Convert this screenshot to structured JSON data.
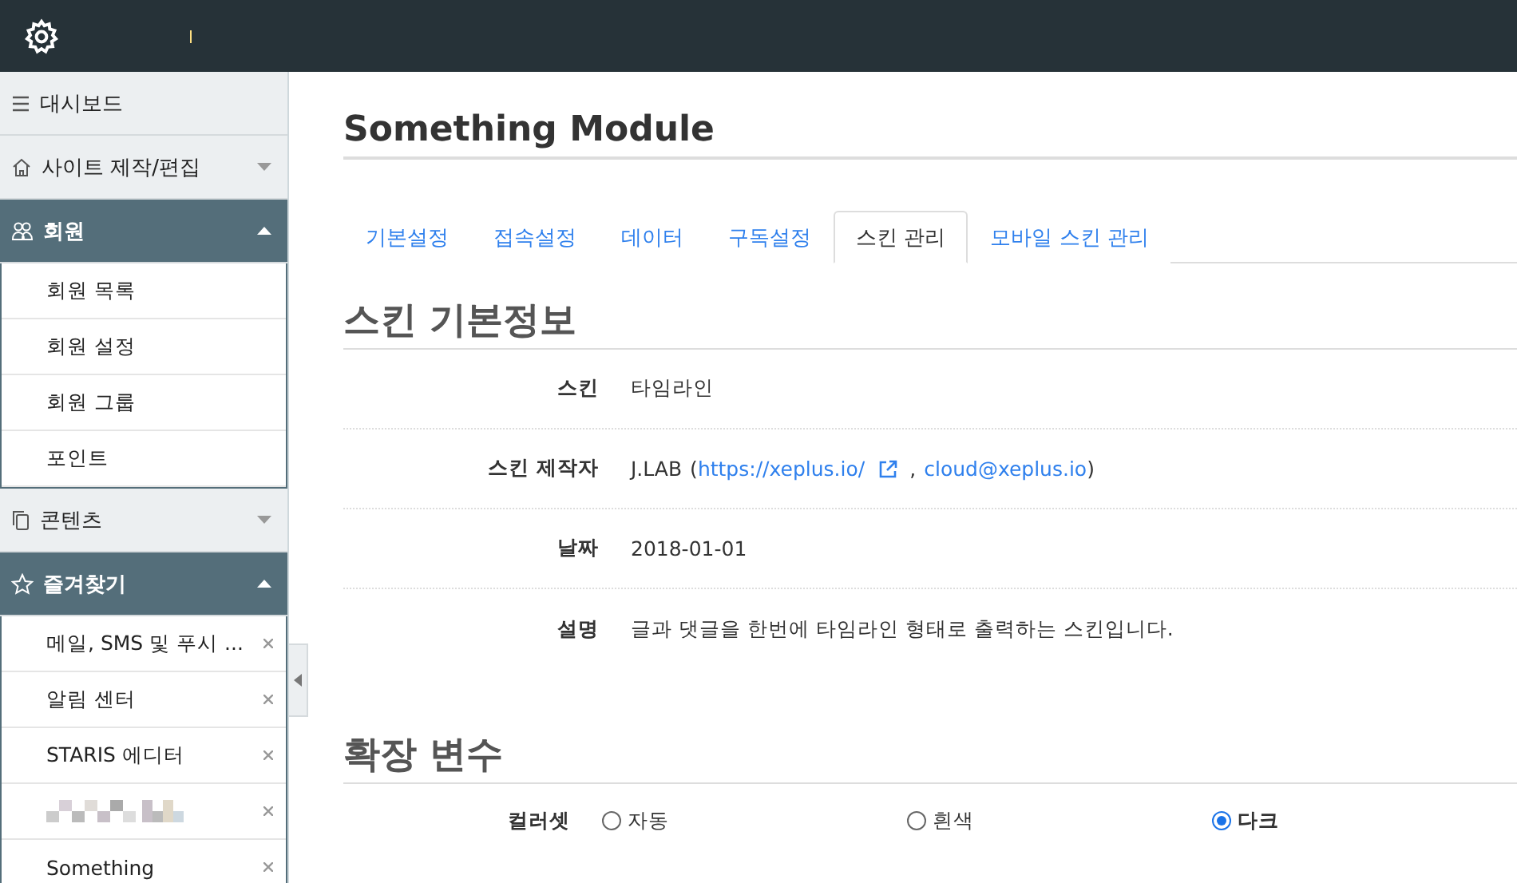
{
  "sidebar": {
    "groups": [
      {
        "label": "대시보드"
      },
      {
        "label": "사이트 제작/편집",
        "expanded": false
      },
      {
        "label": "회원",
        "expanded": true,
        "children": [
          {
            "label": "회원 목록"
          },
          {
            "label": "회원 설정"
          },
          {
            "label": "회원 그룹"
          },
          {
            "label": "포인트"
          }
        ]
      },
      {
        "label": "콘텐츠",
        "expanded": false
      },
      {
        "label": "즐겨찾기",
        "expanded": true,
        "children": [
          {
            "label": "메일, SMS 및 푸시 ...",
            "removable": true
          },
          {
            "label": "알림 센터",
            "removable": true
          },
          {
            "label": "STARIS 에디터",
            "removable": true
          },
          {
            "kind": "blurred",
            "removable": true
          },
          {
            "label": "Something",
            "removable": true
          }
        ]
      }
    ]
  },
  "page": {
    "title": "Something Module",
    "tabs": [
      {
        "label": "기본설정",
        "selected": false
      },
      {
        "label": "접속설정",
        "selected": false
      },
      {
        "label": "데이터",
        "selected": false
      },
      {
        "label": "구독설정",
        "selected": false
      },
      {
        "label": "스킨 관리",
        "selected": true
      },
      {
        "label": "모바일 스킨 관리",
        "selected": false
      }
    ],
    "skin_info": {
      "heading": "스킨 기본정보",
      "rows": [
        {
          "kind": "text",
          "label": "스킨",
          "value": "타임라인"
        },
        {
          "kind": "author",
          "label": "스킨 제작자",
          "name": "J.LAB",
          "open": "(",
          "separator": ",",
          "close": ")",
          "url": "https://xeplus.io/",
          "email": "cloud@xeplus.io"
        },
        {
          "kind": "text",
          "label": "날짜",
          "value": "2018-01-01"
        },
        {
          "kind": "text",
          "label": "설명",
          "value": "글과 댓글을 한번에 타임라인 형태로 출력하는 스킨입니다."
        }
      ]
    },
    "extra_vars": {
      "heading": "확장 변수",
      "rows": [
        {
          "label": "컬러셋",
          "options": [
            {
              "label": "자동",
              "selected": false
            },
            {
              "label": "흰색",
              "selected": false
            },
            {
              "label": "다크",
              "selected": true
            }
          ]
        }
      ]
    }
  }
}
